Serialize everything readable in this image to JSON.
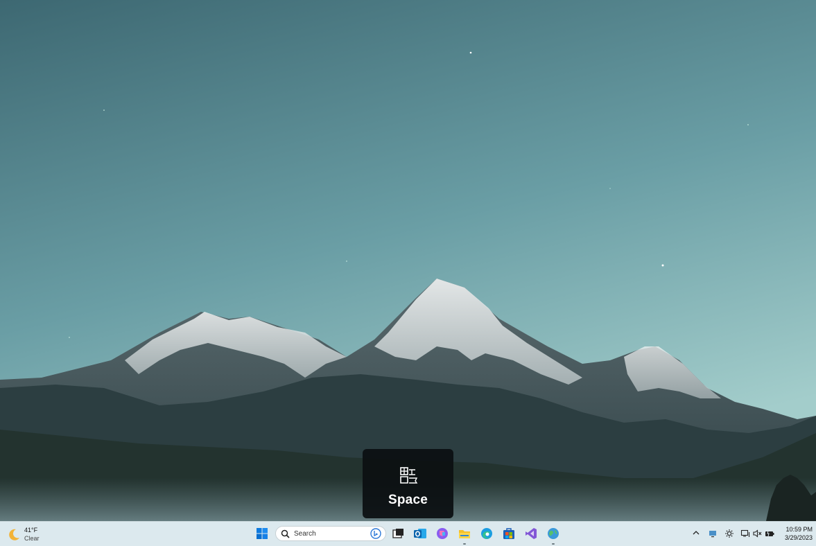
{
  "ime_popup": {
    "icon": "ime-mode-icon",
    "label": "Space"
  },
  "taskbar": {
    "weather": {
      "temp": "41°F",
      "condition": "Clear",
      "icon": "moon-icon"
    },
    "start": {
      "icon": "windows-start-icon"
    },
    "search": {
      "placeholder": "Search",
      "icon": "search-icon",
      "bing_icon": "bing-icon"
    },
    "apps": [
      {
        "name": "task-view",
        "icon": "task-view-icon"
      },
      {
        "name": "outlook",
        "icon": "outlook-icon"
      },
      {
        "name": "copilot",
        "icon": "copilot-icon"
      },
      {
        "name": "file-explorer",
        "icon": "folder-icon",
        "running": true
      },
      {
        "name": "edge",
        "icon": "edge-icon"
      },
      {
        "name": "store",
        "icon": "store-icon"
      },
      {
        "name": "visual-studio",
        "icon": "visual-studio-icon"
      },
      {
        "name": "globe-app",
        "icon": "globe-icon",
        "running": true
      }
    ],
    "tray": {
      "icons": [
        "chevron-up-icon",
        "display-icon",
        "brightness-icon",
        "network-icon",
        "volume-mute-icon",
        "battery-icon"
      ]
    },
    "clock": {
      "time": "10:59 PM",
      "date": "3/29/2023"
    }
  },
  "colors": {
    "taskbar_bg": "#dce9ee",
    "popup_bg": "#0c1012",
    "accent": "#0078d4"
  }
}
